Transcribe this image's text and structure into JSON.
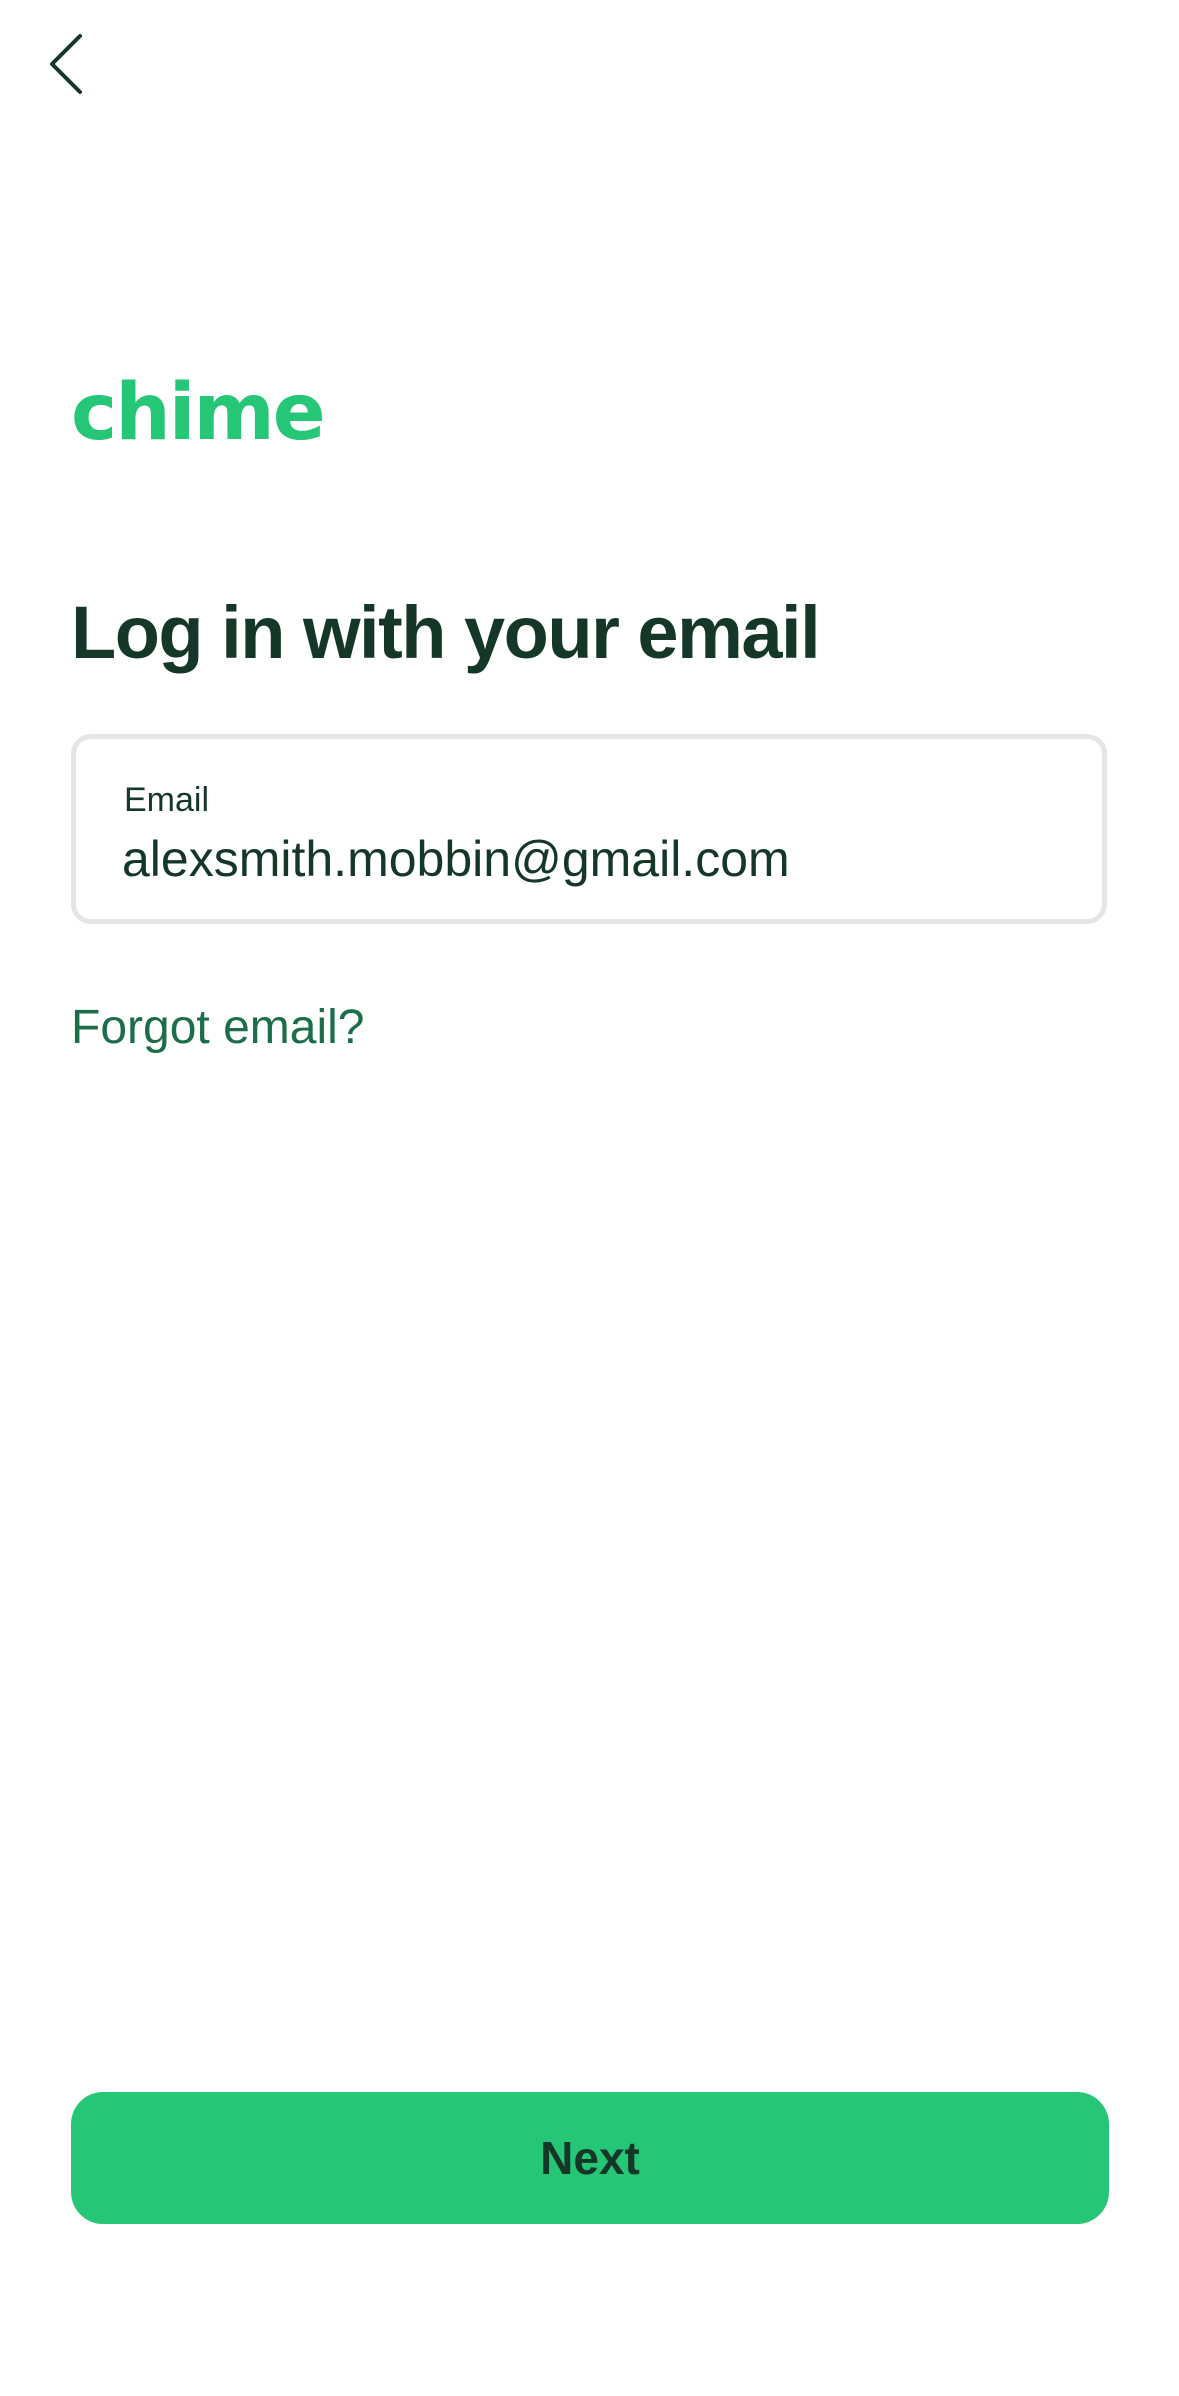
{
  "theme": {
    "brand_green": "#25c777",
    "text_dark": "#153728",
    "link_green": "#1b6e49",
    "border_gray": "#e5e5e5"
  },
  "nav": {
    "back_icon": "chevron-left-icon"
  },
  "logo": {
    "text": "chime"
  },
  "page": {
    "title": "Log in with your email"
  },
  "email_field": {
    "label": "Email",
    "value": "alexsmith.mobbin@gmail.com"
  },
  "links": {
    "forgot_email": "Forgot email?"
  },
  "actions": {
    "next_label": "Next"
  }
}
